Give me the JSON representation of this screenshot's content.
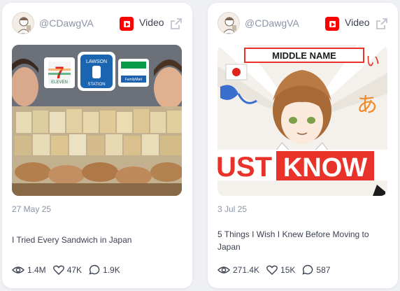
{
  "cards": [
    {
      "author": "@CDawgVA",
      "type_label": "Video",
      "date": "27 May 25",
      "title": "I Tried Every Sandwich in Japan",
      "thumb_text": [
        "7",
        "ELEVEN",
        "LAWSON",
        "STATION",
        "FamilyMart"
      ],
      "stats": {
        "views": "1.4M",
        "likes": "47K",
        "comments": "1.9K"
      }
    },
    {
      "author": "@CDawgVA",
      "type_label": "Video",
      "date": "3 Jul 25",
      "title": "5 Things I Wish I Knew Before Moving to Japan",
      "thumb_text": [
        "MIDDLE NAME",
        "UST",
        "KNOW",
        "あ",
        "い"
      ],
      "stats": {
        "views": "271.4K",
        "likes": "15K",
        "comments": "587"
      }
    }
  ],
  "icons": {
    "platform": "youtube-icon",
    "external": "external-link-icon",
    "views": "eye-icon",
    "likes": "heart-icon",
    "comments": "comment-icon"
  },
  "colors": {
    "youtube_red": "#ff0000",
    "muted_text": "#8b93a5",
    "body_text": "#3c4253",
    "card_bg": "#ffffff",
    "page_bg": "#eef0f4"
  }
}
